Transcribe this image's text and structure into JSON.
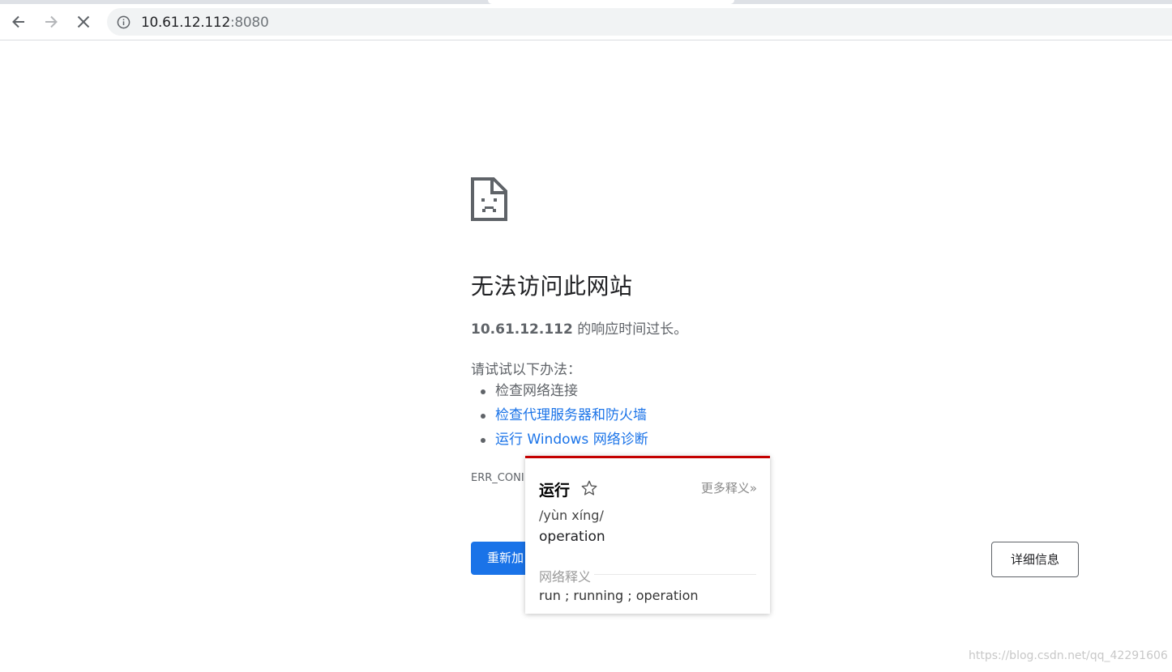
{
  "browser": {
    "url_host": "10.61.12.112",
    "url_port": ":8080",
    "back_icon": "arrow-left-icon",
    "forward_icon": "arrow-right-icon",
    "stop_icon": "close-icon",
    "site_info_icon": "info-icon"
  },
  "error_page": {
    "icon": "sad-page-icon",
    "title": "无法访问此网站",
    "host": "10.61.12.112",
    "description_suffix": " 的响应时间过长。",
    "try_label": "请试试以下办法：",
    "suggestions": [
      {
        "label": "检查网络连接",
        "link": false
      },
      {
        "label": "检查代理服务器和防火墙",
        "link": true
      },
      {
        "label": "运行 Windows 网络诊断",
        "link": true
      }
    ],
    "error_code": "ERR_CONI",
    "reload_label": "重新加",
    "details_label": "详细信息"
  },
  "dictionary_popup": {
    "word": "运行",
    "star_icon": "star-icon",
    "more_label": "更多释义»",
    "phonetic": "/yùn xíng/",
    "meaning": "operation",
    "section_label": "网络释义",
    "web_meanings": "run ; running ; operation",
    "accent_color": "#c40000"
  },
  "watermark": "https://blog.csdn.net/qq_42291606",
  "colors": {
    "link": "#1a73e8",
    "primary_button": "#1a73e8",
    "text_secondary": "#5f6368"
  }
}
